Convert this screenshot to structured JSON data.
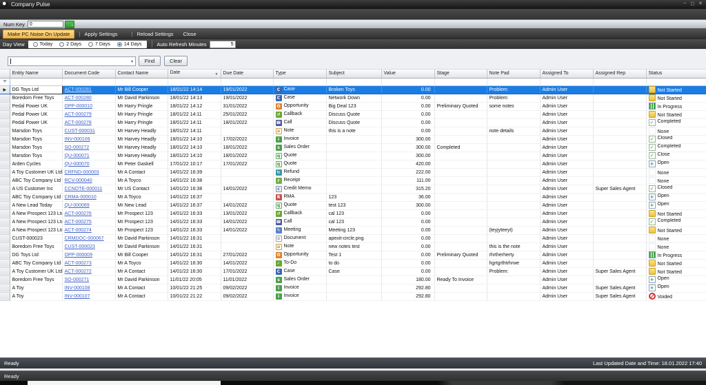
{
  "titlebar": {
    "title": "Company Pulse",
    "minimize": "–",
    "maximize": "◻",
    "close": "✕"
  },
  "numkey": {
    "label": "Num Key",
    "value": "0",
    "go_icon": "→"
  },
  "toolbar": {
    "noise": "Make PC Noise On Update",
    "apply": "Apply Settings",
    "reload": "Reload Settings",
    "close": "Close"
  },
  "dayview": {
    "label": "Day View",
    "options": [
      {
        "label": "Today",
        "selected": false
      },
      {
        "label": "2 Days",
        "selected": false
      },
      {
        "label": "7 Days",
        "selected": false
      },
      {
        "label": "14 Days",
        "selected": true
      }
    ],
    "auto_refresh_label": "Auto Refresh Minutes",
    "auto_refresh_value": "5"
  },
  "search": {
    "value": "",
    "find": "Find",
    "clear": "Clear"
  },
  "grid": {
    "columns": [
      "Entity Name",
      "Document Code",
      "Contact Name",
      "Date",
      "Due Date",
      "Type",
      "Subject",
      "Value",
      "Stage",
      "Note Pad",
      "Assigned To",
      "Assigned Rep",
      "Status"
    ],
    "sorted_column": "Date",
    "rows": [
      {
        "selected": true,
        "entity": "DG Toys Ltd",
        "code": "ACT-000281",
        "contact": "Mr Bill Cooper",
        "date": "18/01/22 14:14",
        "due": "19/01/2022",
        "type": "Case",
        "subject": "Broken Toys",
        "value": "0.00",
        "stage": "",
        "notepad": "Problem:",
        "assigned_to": "Admin User",
        "assigned_rep": "",
        "status": "Not Started"
      },
      {
        "entity": "Boredom Free Toys",
        "code": "ACT-000280",
        "contact": "Mr David Parkinson",
        "date": "18/01/22 14:13",
        "due": "19/01/2022",
        "type": "Case",
        "subject": "Network Down",
        "value": "0.00",
        "stage": "",
        "notepad": "Problem:",
        "assigned_to": "Admin User",
        "assigned_rep": "",
        "status": "Not Started"
      },
      {
        "entity": "Pedal Power UK",
        "code": "OPP-000010",
        "contact": "Mr Harry Pringle",
        "date": "18/01/22 14:12",
        "due": "31/01/2022",
        "type": "Opportunity",
        "subject": "Big Deal 123",
        "value": "0.00",
        "stage": "Preliminary Quoted",
        "notepad": "some notes",
        "assigned_to": "Admin User",
        "assigned_rep": "",
        "status": "In Progress"
      },
      {
        "entity": "Pedal Power UK",
        "code": "ACT-000279",
        "contact": "Mr Harry Pringle",
        "date": "18/01/22 14:11",
        "due": "25/01/2022",
        "type": "Callback",
        "subject": "Discuss Quote",
        "value": "0.00",
        "stage": "",
        "notepad": "",
        "assigned_to": "Admin User",
        "assigned_rep": "",
        "status": "Not Started"
      },
      {
        "entity": "Pedal Power UK",
        "code": "ACT-000278",
        "contact": "Mr Harry Pringle",
        "date": "18/01/22 14:11",
        "due": "18/01/2022",
        "type": "Call",
        "subject": "Discuss Quote",
        "value": "0.00",
        "stage": "",
        "notepad": "",
        "assigned_to": "Admin User",
        "assigned_rep": "",
        "status": "Completed"
      },
      {
        "entity": "Marsdon Toys",
        "code": "CUST-000031",
        "contact": "Mr Harvey Headly",
        "date": "18/01/22 14:11",
        "due": "",
        "type": "Note",
        "subject": "this is a note",
        "value": "0.00",
        "stage": "",
        "notepad": "note details",
        "assigned_to": "Admin User",
        "assigned_rep": "",
        "status": "None"
      },
      {
        "entity": "Marsdon Toys",
        "code": "INV-000109",
        "contact": "Mr Harvey Headly",
        "date": "18/01/22 14:10",
        "due": "17/02/2022",
        "type": "Invoice",
        "subject": "",
        "value": "300.00",
        "stage": "",
        "notepad": "",
        "assigned_to": "Admin User",
        "assigned_rep": "",
        "status": "Closed"
      },
      {
        "entity": "Marsdon Toys",
        "code": "SO-000272",
        "contact": "Mr Harvey Headly",
        "date": "18/01/22 14:10",
        "due": "18/01/2022",
        "type": "Sales Order",
        "subject": "",
        "value": "300.00",
        "stage": "Completed",
        "notepad": "",
        "assigned_to": "Admin User",
        "assigned_rep": "",
        "status": "Completed"
      },
      {
        "entity": "Marsdon Toys",
        "code": "QU-000071",
        "contact": "Mr Harvey Headly",
        "date": "18/01/22 14:10",
        "due": "18/01/2022",
        "type": "Quote",
        "subject": "",
        "value": "300.00",
        "stage": "",
        "notepad": "",
        "assigned_to": "Admin User",
        "assigned_rep": "",
        "status": "Close"
      },
      {
        "entity": "Arden Cycles",
        "code": "QU-000070",
        "contact": "Mr Peter Gaskell",
        "date": "17/01/22 10:17",
        "due": "17/01/2022",
        "type": "Quote",
        "subject": "",
        "value": "420.00",
        "stage": "",
        "notepad": "",
        "assigned_to": "Admin User",
        "assigned_rep": "",
        "status": "Open"
      },
      {
        "entity": "A Toy Customer UK Ltd",
        "code": "CRFND-000003",
        "contact": "Mr A Contact",
        "date": "14/01/22 16:39",
        "due": "",
        "type": "Refund",
        "subject": "",
        "value": "222.00",
        "stage": "",
        "notepad": "",
        "assigned_to": "Admin User",
        "assigned_rep": "",
        "status": "None"
      },
      {
        "entity": "ABC Toy Company Ltd",
        "code": "RCV-000040",
        "contact": "Mr A Toyco",
        "date": "14/01/22 16:38",
        "due": "",
        "type": "Receipt",
        "subject": "",
        "value": "111.00",
        "stage": "",
        "notepad": "",
        "assigned_to": "Admin User",
        "assigned_rep": "",
        "status": "None"
      },
      {
        "entity": "A US Customer Inc",
        "code": "CCNOTE-000011",
        "contact": "Mr US Contact",
        "date": "14/01/22 16:38",
        "due": "14/01/2022",
        "type": "Credit Memo",
        "subject": "",
        "value": "315.20",
        "stage": "",
        "notepad": "",
        "assigned_to": "Admin User",
        "assigned_rep": "Super Sales Agent",
        "status": "Closed"
      },
      {
        "entity": "ABC Toy Company Ltd",
        "code": "CRMA-000010",
        "contact": "Mr A Toyco",
        "date": "14/01/22 16:37",
        "due": "",
        "type": "RMA",
        "subject": "123",
        "value": "36.00",
        "stage": "",
        "notepad": "",
        "assigned_to": "Admin User",
        "assigned_rep": "",
        "status": "Open"
      },
      {
        "entity": "A New Lead Today",
        "code": "QU-000069",
        "contact": "Mr New Lead",
        "date": "14/01/22 16:37",
        "due": "14/01/2022",
        "type": "Quote",
        "subject": "test 123",
        "value": "300.00",
        "stage": "",
        "notepad": "",
        "assigned_to": "Admin User",
        "assigned_rep": "",
        "status": "Open"
      },
      {
        "entity": "A New Prospect 123 Ltd",
        "code": "ACT-000276",
        "contact": "Mr Prospect 123",
        "date": "14/01/22 16:33",
        "due": "13/01/2022",
        "type": "Callback",
        "subject": "cal 123",
        "value": "0.00",
        "stage": "",
        "notepad": "",
        "assigned_to": "Admin User",
        "assigned_rep": "",
        "status": "Not Started"
      },
      {
        "entity": "A New Prospect 123 Ltd",
        "code": "ACT-000275",
        "contact": "Mr Prospect 123",
        "date": "14/01/22 16:33",
        "due": "14/01/2022",
        "type": "Call",
        "subject": "cal 123",
        "value": "0.00",
        "stage": "",
        "notepad": "",
        "assigned_to": "Admin User",
        "assigned_rep": "",
        "status": "Completed"
      },
      {
        "entity": "A New Prospect 123 Ltd",
        "code": "ACT-000274",
        "contact": "Mr Prospect 123",
        "date": "14/01/22 16:33",
        "due": "14/01/2022",
        "type": "Meeting",
        "subject": "Meeting 123",
        "value": "0.00",
        "stage": "",
        "notepad": "(teyjyteeyt)",
        "assigned_to": "Admin User",
        "assigned_rep": "",
        "status": "Not Started"
      },
      {
        "entity": "CUST-000023",
        "code": "CRMDOC-000067",
        "contact": "Mr David Parkinson",
        "date": "14/01/22 16:31",
        "due": "",
        "type": "Document",
        "subject": "apexit-circle.png",
        "value": "0.00",
        "stage": "",
        "notepad": "",
        "assigned_to": "Admin User",
        "assigned_rep": "",
        "status": "None"
      },
      {
        "entity": "Boredom Free Toys",
        "code": "CUST-000023",
        "contact": "Mr David Parkinson",
        "date": "14/01/22 16:31",
        "due": "",
        "type": "Note",
        "subject": "new notes test",
        "value": "0.00",
        "stage": "",
        "notepad": "this is the note",
        "assigned_to": "Admin User",
        "assigned_rep": "",
        "status": "None"
      },
      {
        "entity": "DG Toys Ltd",
        "code": "OPP-000009",
        "contact": "Mr Bill Cooper",
        "date": "14/01/22 16:31",
        "due": "27/01/2022",
        "type": "Opportunity",
        "subject": "Test 1",
        "value": "0.00",
        "stage": "Preliminary Quoted",
        "notepad": "rhrtherherty",
        "assigned_to": "Admin User",
        "assigned_rep": "",
        "status": "In Progress"
      },
      {
        "entity": "ABC Toy Company Ltd",
        "code": "ACT-000273",
        "contact": "Mr A Toyco",
        "date": "14/01/22 16:30",
        "due": "14/01/2022",
        "type": "To-Do",
        "subject": "to do",
        "value": "0.00",
        "stage": "",
        "notepad": "hgrtgrthtrhrwe",
        "assigned_to": "Admin User",
        "assigned_rep": "",
        "status": "Not Started"
      },
      {
        "entity": "A Toy Customer UK Ltd",
        "code": "ACT-000272",
        "contact": "Mr A Contact",
        "date": "14/01/22 16:30",
        "due": "17/01/2022",
        "type": "Case",
        "subject": "Case",
        "value": "0.00",
        "stage": "",
        "notepad": "Problem:",
        "assigned_to": "Admin User",
        "assigned_rep": "Super Sales Agent",
        "status": "Not Started"
      },
      {
        "entity": "Boredom Free Toys",
        "code": "SO-000271",
        "contact": "Mr David Parkinson",
        "date": "11/01/22 20:05",
        "due": "11/01/2022",
        "type": "Sales Order",
        "subject": "",
        "value": "180.00",
        "stage": "Ready To Invoice",
        "notepad": "",
        "assigned_to": "Admin User",
        "assigned_rep": "",
        "status": "Open"
      },
      {
        "entity": "A Toy",
        "code": "INV-000108",
        "contact": "Mr A Contact",
        "date": "10/01/22 21:25",
        "due": "09/02/2022",
        "type": "Invoice",
        "subject": "",
        "value": "292.80",
        "stage": "",
        "notepad": "",
        "assigned_to": "Admin User",
        "assigned_rep": "Super Sales Agent",
        "status": "Open"
      },
      {
        "entity": "A Toy",
        "code": "INV-000107",
        "contact": "Mr A Contact",
        "date": "10/01/22 21:22",
        "due": "09/02/2022",
        "type": "Invoice",
        "subject": "",
        "value": "292.80",
        "stage": "",
        "notepad": "",
        "assigned_to": "Admin User",
        "assigned_rep": "Super Sales Agent",
        "status": "Voided"
      }
    ]
  },
  "statusbar": {
    "left": "Ready",
    "right": "Last Updated Date and Time: 18.01.2022 17:40"
  },
  "statusbar2": {
    "left": "Ready"
  },
  "colors": {
    "selection_blue": "#1b7de4",
    "toolbar_button_orange": "#f2b54b",
    "link_blue": "#3f62c8"
  }
}
